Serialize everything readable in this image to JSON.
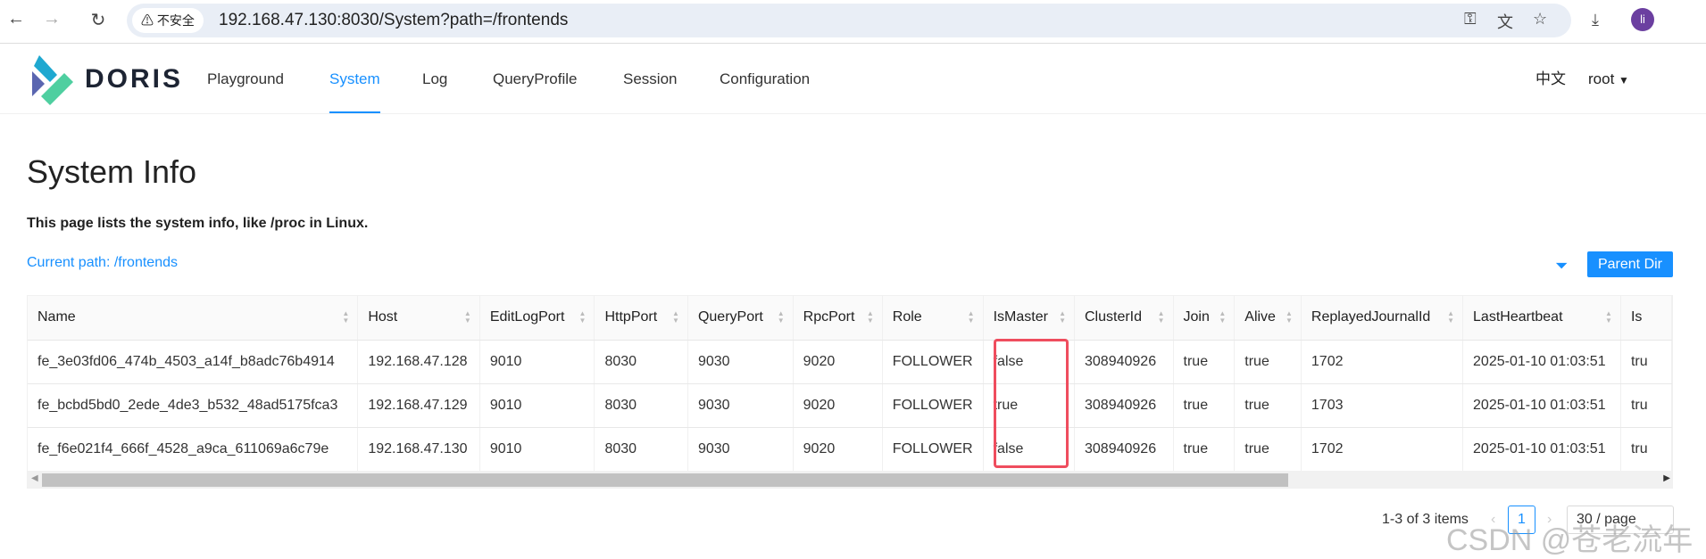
{
  "browser": {
    "security_label": "不安全",
    "url": "192.168.47.130:8030/System?path=/frontends",
    "profile_initial": "li"
  },
  "header": {
    "logo_text": "DORIS",
    "nav": [
      "Playground",
      "System",
      "Log",
      "QueryProfile",
      "Session",
      "Configuration"
    ],
    "active": "System",
    "language": "中文",
    "user": "root"
  },
  "page": {
    "title": "System Info",
    "description": "This page lists the system info, like /proc in Linux.",
    "current_path": "Current path: /frontends",
    "parent_dir_label": "Parent Dir"
  },
  "table": {
    "columns": [
      "Name",
      "Host",
      "EditLogPort",
      "HttpPort",
      "QueryPort",
      "RpcPort",
      "Role",
      "IsMaster",
      "ClusterId",
      "Join",
      "Alive",
      "ReplayedJournalId",
      "LastHeartbeat",
      "Is"
    ],
    "rows": [
      [
        "fe_3e03fd06_474b_4503_a14f_b8adc76b4914",
        "192.168.47.128",
        "9010",
        "8030",
        "9030",
        "9020",
        "FOLLOWER",
        "false",
        "308940926",
        "true",
        "true",
        "1702",
        "2025-01-10 01:03:51",
        "tru"
      ],
      [
        "fe_bcbd5bd0_2ede_4de3_b532_48ad5175fca3",
        "192.168.47.129",
        "9010",
        "8030",
        "9030",
        "9020",
        "FOLLOWER",
        "true",
        "308940926",
        "true",
        "true",
        "1703",
        "2025-01-10 01:03:51",
        "tru"
      ],
      [
        "fe_f6e021f4_666f_4528_a9ca_611069a6c79e",
        "192.168.47.130",
        "9010",
        "8030",
        "9030",
        "9020",
        "FOLLOWER",
        "false",
        "308940926",
        "true",
        "true",
        "1702",
        "2025-01-10 01:03:51",
        "tru"
      ]
    ],
    "highlight_column": "IsMaster",
    "highlight_color": "#ef4d5e"
  },
  "pagination": {
    "summary": "1-3 of 3 items",
    "current_page": "1",
    "page_size": "30 / page"
  },
  "watermark": "CSDN @苍老流年",
  "colors": {
    "accent": "#1890ff"
  }
}
